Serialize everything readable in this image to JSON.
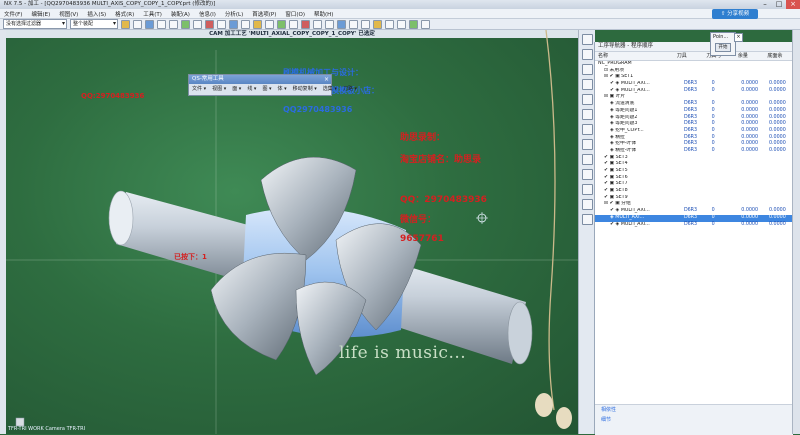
{
  "titlebar": {
    "text": "NX 7.5 - 加工 - [QQ2970483936 MULTI_AXIS_COPY_COPY_1_COPY.prt (修改的)]",
    "minimize": "–",
    "maximize": "□",
    "close": "×"
  },
  "menubar": {
    "items": [
      "文件(F)",
      "编辑(E)",
      "视图(V)",
      "插入(S)",
      "格式(R)",
      "工具(T)",
      "装配(A)",
      "信息(I)",
      "分析(L)",
      "首选项(P)",
      "窗口(O)",
      "帮助(H)"
    ]
  },
  "share_button": "⇧ 分享视频",
  "toolbar": {
    "selection_filter": "没有选择过滤器",
    "assembly_scope": "整个装配"
  },
  "viewport": {
    "title": "CAM 加工工艺 'MULTI_AXIAL_COPY_COPY_1_COPY' 已选定",
    "red_text_1": "QQ:2970483936",
    "blue_heading": "刷模机械加工与设计：",
    "blue_store": "淘宝店名：刷模模板小店：",
    "blue_qq": "QQ2970483936",
    "red_video": "助思录制：",
    "red_store": "淘宝店铺名：助思录",
    "red_qq": "QQ：2970483936",
    "red_wechat": "微信号：",
    "red_number": "9657761",
    "red_left": "已按下：1",
    "life_text": "life is music...",
    "status": "TFR-TRI WORK Camera TFR-TRI"
  },
  "float_panel": {
    "title": "QS-常用工具",
    "menu": [
      "文件 ▾",
      "视图 ▾",
      "面 ▾",
      "线 ▾",
      "图 ▾",
      "体 ▾",
      "移动复制 ▾",
      "选集 ▾",
      "刀路 ▾"
    ]
  },
  "point_popup": {
    "title": "Poin...",
    "button": "开始",
    "close": "×"
  },
  "navigator": {
    "title": "工序导航器 - 程序顺序",
    "columns": [
      "名称",
      "刀具",
      "刀具号",
      "余量",
      "底面余"
    ],
    "rows": [
      {
        "indent": 0,
        "name": "NC_PROGRAM",
        "tool": "",
        "tool_no": "",
        "stock": "",
        "floor": ""
      },
      {
        "indent": 1,
        "name": "⊡ 未用项",
        "tool": "",
        "tool_no": "",
        "stock": "",
        "floor": ""
      },
      {
        "indent": 1,
        "name": "⊟ ✔ ▣ SET1",
        "tool": "",
        "tool_no": "",
        "stock": "",
        "floor": ""
      },
      {
        "indent": 2,
        "name": "✔ ◈ MULTI_AXI...",
        "tool": "D6R3",
        "tool_no": "0",
        "stock": "0.0000",
        "floor": "0.0000"
      },
      {
        "indent": 2,
        "name": "✔ ◈ MULTI_AXI...",
        "tool": "D6R3",
        "tool_no": "0",
        "stock": "0.0000",
        "floor": "0.0000"
      },
      {
        "indent": 1,
        "name": "⊟ ▣ 叶片",
        "tool": "",
        "tool_no": "",
        "stock": "",
        "floor": ""
      },
      {
        "indent": 2,
        "name": "◈ 流道清底",
        "tool": "D6R3",
        "tool_no": "0",
        "stock": "0.0000",
        "floor": "0.0000"
      },
      {
        "indent": 2,
        "name": "◈ 等距问题1",
        "tool": "D6R3",
        "tool_no": "0",
        "stock": "0.0000",
        "floor": "0.0000"
      },
      {
        "indent": 2,
        "name": "◈ 等距问题2",
        "tool": "D6R3",
        "tool_no": "0",
        "stock": "0.0000",
        "floor": "0.0000"
      },
      {
        "indent": 2,
        "name": "◈ 等距问题3",
        "tool": "D6R3",
        "tool_no": "0",
        "stock": "0.0000",
        "floor": "0.0000"
      },
      {
        "indent": 2,
        "name": "◈ 挖中_COPY...",
        "tool": "D6R3",
        "tool_no": "0",
        "stock": "0.0000",
        "floor": "0.0000"
      },
      {
        "indent": 2,
        "name": "◈ 精拉",
        "tool": "D6R3",
        "tool_no": "0",
        "stock": "0.0000",
        "floor": "0.0000"
      },
      {
        "indent": 2,
        "name": "◈ 挖中-叶体",
        "tool": "D6R3",
        "tool_no": "0",
        "stock": "0.0000",
        "floor": "0.0000"
      },
      {
        "indent": 2,
        "name": "◈ 精拉-叶体",
        "tool": "D6R3",
        "tool_no": "0",
        "stock": "0.0000",
        "floor": "0.0000"
      },
      {
        "indent": 1,
        "name": "✔ ▣ SET3",
        "tool": "",
        "tool_no": "",
        "stock": "",
        "floor": ""
      },
      {
        "indent": 1,
        "name": "✔ ▣ SET4",
        "tool": "",
        "tool_no": "",
        "stock": "",
        "floor": ""
      },
      {
        "indent": 1,
        "name": "✔ ▣ SET5",
        "tool": "",
        "tool_no": "",
        "stock": "",
        "floor": ""
      },
      {
        "indent": 1,
        "name": "✔ ▣ SET6",
        "tool": "",
        "tool_no": "",
        "stock": "",
        "floor": ""
      },
      {
        "indent": 1,
        "name": "✔ ▣ SET7",
        "tool": "",
        "tool_no": "",
        "stock": "",
        "floor": ""
      },
      {
        "indent": 1,
        "name": "✔ ▣ SET8",
        "tool": "",
        "tool_no": "",
        "stock": "",
        "floor": ""
      },
      {
        "indent": 1,
        "name": "✔ ▣ SET9",
        "tool": "",
        "tool_no": "",
        "stock": "",
        "floor": ""
      },
      {
        "indent": 1,
        "name": "⊟ ✔ ▣ 分组",
        "tool": "",
        "tool_no": "",
        "stock": "",
        "floor": ""
      },
      {
        "indent": 2,
        "name": "✔ ◈ MULTI_AXI...",
        "tool": "D6R3",
        "tool_no": "0",
        "stock": "0.0000",
        "floor": "0.0000"
      },
      {
        "indent": 2,
        "name": "◈ MULTI_AXI...",
        "tool": "D6R3",
        "tool_no": "0",
        "stock": "0.0000",
        "floor": "0.0000",
        "selected": true
      },
      {
        "indent": 2,
        "name": "✔ ◈ MULTI_AXI...",
        "tool": "D6R3",
        "tool_no": "0",
        "stock": "0.0000",
        "floor": "0.0000"
      }
    ],
    "bottom": [
      "相依性",
      "细节"
    ]
  },
  "colors": {
    "viewport_green": "#2e6d40",
    "selection_blue": "#3d86e0",
    "part_blue": "#9ec3ee",
    "watermark_red": "#d42020",
    "watermark_blue": "#2a6be0"
  }
}
